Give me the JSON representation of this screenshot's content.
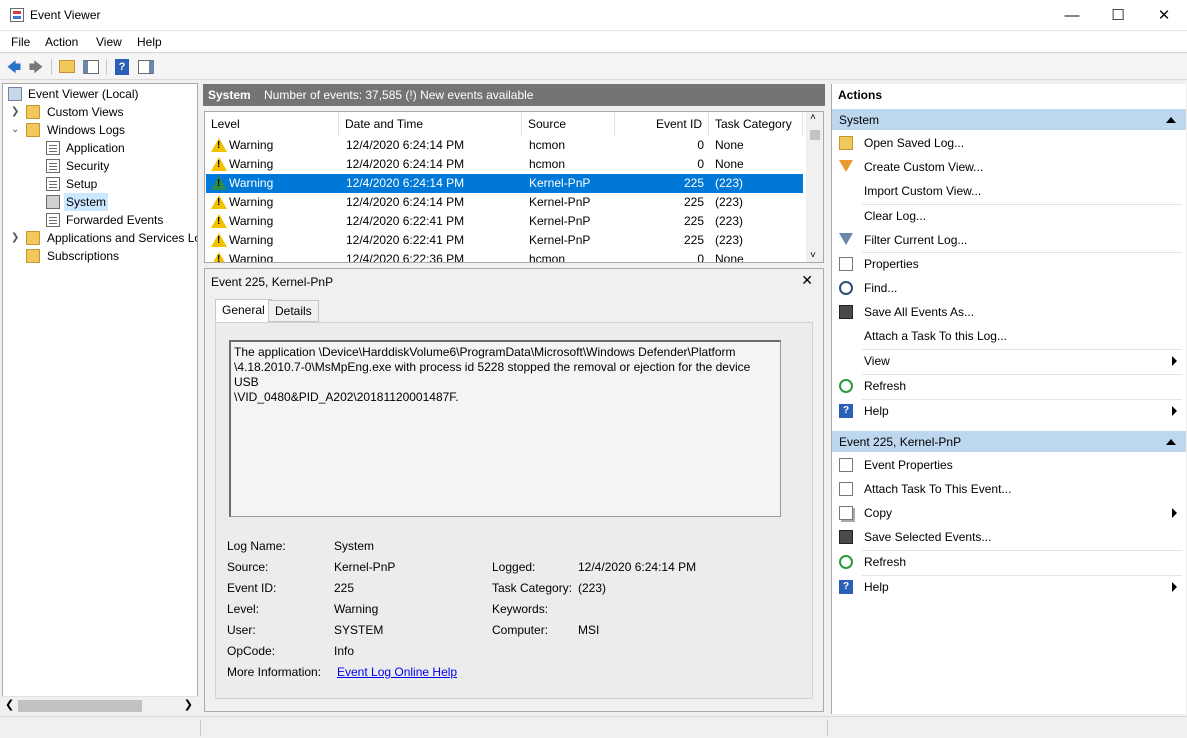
{
  "window": {
    "title": "Event Viewer"
  },
  "menu": {
    "file": "File",
    "action": "Action",
    "view": "View",
    "help": "Help"
  },
  "tree": {
    "root": "Event Viewer (Local)",
    "custom_views": "Custom Views",
    "windows_logs": "Windows Logs",
    "application": "Application",
    "security": "Security",
    "setup": "Setup",
    "system": "System",
    "forwarded": "Forwarded Events",
    "apps_services": "Applications and Services Lo",
    "subscriptions": "Subscriptions"
  },
  "center": {
    "log_name": "System",
    "summary": "Number of events: 37,585 (!) New events available",
    "columns": {
      "level": "Level",
      "datetime": "Date and Time",
      "source": "Source",
      "event_id": "Event ID",
      "task_category": "Task Category"
    },
    "rows": [
      {
        "level": "Warning",
        "datetime": "12/4/2020 6:24:14 PM",
        "source": "hcmon",
        "event_id": "0",
        "task": "None"
      },
      {
        "level": "Warning",
        "datetime": "12/4/2020 6:24:14 PM",
        "source": "hcmon",
        "event_id": "0",
        "task": "None"
      },
      {
        "level": "Warning",
        "datetime": "12/4/2020 6:24:14 PM",
        "source": "Kernel-PnP",
        "event_id": "225",
        "task": "(223)"
      },
      {
        "level": "Warning",
        "datetime": "12/4/2020 6:24:14 PM",
        "source": "Kernel-PnP",
        "event_id": "225",
        "task": "(223)"
      },
      {
        "level": "Warning",
        "datetime": "12/4/2020 6:22:41 PM",
        "source": "Kernel-PnP",
        "event_id": "225",
        "task": "(223)"
      },
      {
        "level": "Warning",
        "datetime": "12/4/2020 6:22:41 PM",
        "source": "Kernel-PnP",
        "event_id": "225",
        "task": "(223)"
      },
      {
        "level": "Warning",
        "datetime": "12/4/2020 6:22:36 PM",
        "source": "hcmon",
        "event_id": "0",
        "task": "None"
      }
    ]
  },
  "detail": {
    "title": "Event 225, Kernel-PnP",
    "tab_general": "General",
    "tab_details": "Details",
    "message_lines": [
      "The application \\Device\\HarddiskVolume6\\ProgramData\\Microsoft\\Windows Defender\\Platform",
      "\\4.18.2010.7-0\\MsMpEng.exe with process id 5228 stopped the removal or ejection for the device USB",
      "\\VID_0480&PID_A202\\20181120001487F."
    ],
    "labels": {
      "log_name": "Log Name:",
      "source": "Source:",
      "event_id": "Event ID:",
      "level": "Level:",
      "user": "User:",
      "opcode": "OpCode:",
      "more_info": "More Information:",
      "logged": "Logged:",
      "task_category": "Task Category:",
      "keywords": "Keywords:",
      "computer": "Computer:"
    },
    "values": {
      "log_name": "System",
      "source": "Kernel-PnP",
      "event_id": "225",
      "level": "Warning",
      "user": "SYSTEM",
      "opcode": "Info",
      "more_info": "Event Log Online Help",
      "logged": "12/4/2020 6:24:14 PM",
      "task_category": "(223)",
      "keywords": "",
      "computer": "MSI"
    }
  },
  "actions": {
    "header": "Actions",
    "section1": "System",
    "items1": {
      "open_saved": "Open Saved Log...",
      "create_custom": "Create Custom View...",
      "import_custom": "Import Custom View...",
      "clear_log": "Clear Log...",
      "filter": "Filter Current Log...",
      "properties": "Properties",
      "find": "Find...",
      "save_all": "Save All Events As...",
      "attach_task_log": "Attach a Task To this Log...",
      "view": "View",
      "refresh": "Refresh",
      "help": "Help"
    },
    "section2": "Event 225, Kernel-PnP",
    "items2": {
      "event_props": "Event Properties",
      "attach_task_event": "Attach Task To This Event...",
      "copy": "Copy",
      "save_selected": "Save Selected Events...",
      "refresh": "Refresh",
      "help": "Help"
    }
  }
}
